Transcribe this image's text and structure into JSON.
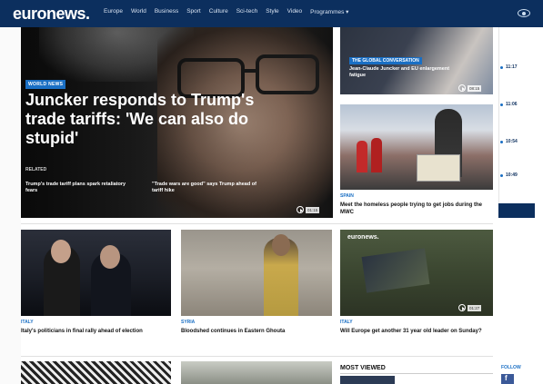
{
  "nav": {
    "logo_light": "euro",
    "logo_bold": "news.",
    "items": [
      "Europe",
      "World",
      "Business",
      "Sport",
      "Culture",
      "Sci-tech",
      "Style",
      "Video",
      "Programmes ▾"
    ]
  },
  "hero": {
    "tag": "WORLD NEWS",
    "title": "Juncker responds to Trump's trade tariffs: 'We can also do stupid'",
    "related_label": "RELATED",
    "related": [
      "Trump's trade tariff plans spark retaliatory fears",
      "\"Trade wars are good\" says Trump ahead of tariff hike"
    ],
    "duration": "01:15"
  },
  "right_cards": [
    {
      "tag": "THE GLOBAL CONVERSATION",
      "title": "Jean-Claude Juncker and EU enlargement fatigue",
      "duration": "08:15"
    },
    {
      "section": "SPAIN",
      "title": "Meet the homeless people trying to get jobs during the MWC"
    }
  ],
  "timeline": {
    "times": [
      "11:17",
      "11:06",
      "10:54",
      "10:49"
    ]
  },
  "row2": [
    {
      "section": "ITALY",
      "title": "Italy's politicians in final rally ahead of election"
    },
    {
      "section": "SYRIA",
      "title": "Bloodshed continues in Eastern Ghouta"
    },
    {
      "section": "ITALY",
      "title": "Will Europe get another 31 year old leader on Sunday?",
      "logo": "euronews.",
      "duration": "01:27"
    }
  ],
  "most_viewed": {
    "label": "MOST VIEWED"
  },
  "follow": {
    "label": "FOLLOW",
    "fb": "f"
  }
}
